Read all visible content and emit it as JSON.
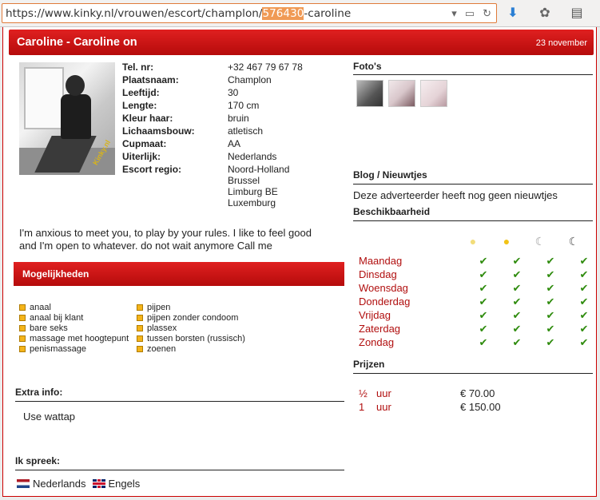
{
  "browser": {
    "url_prefix": "https://www.kinky.nl/vrouwen/escort/champlon/",
    "url_highlight": "576430",
    "url_suffix": "-caroline",
    "dropdown_icon": "chevron-down-icon",
    "reader_icon": "reader-view-icon",
    "reload_icon": "reload-icon",
    "download_icon": "download-arrow-icon",
    "extension_icon": "extension-icon",
    "clipboard_icon": "clipboard-icon"
  },
  "header": {
    "title": "Caroline - Caroline on",
    "date": "23 november"
  },
  "photo": {
    "watermark": "Kinky.nl"
  },
  "profile": {
    "rows": [
      {
        "label": "Tel. nr:",
        "value": [
          "+32 467 79 67 78"
        ]
      },
      {
        "label": "Plaatsnaam:",
        "value": [
          "Champlon"
        ]
      },
      {
        "label": "Leeftijd:",
        "value": [
          "30"
        ]
      },
      {
        "label": "Lengte:",
        "value": [
          "170 cm"
        ]
      },
      {
        "label": "Kleur haar:",
        "value": [
          "bruin"
        ]
      },
      {
        "label": "Lichaamsbouw:",
        "value": [
          "atletisch"
        ]
      },
      {
        "label": "Cupmaat:",
        "value": [
          "AA"
        ]
      },
      {
        "label": "Uiterlijk:",
        "value": [
          "Nederlands"
        ]
      },
      {
        "label": "Escort regio:",
        "value": [
          "Noord-Holland",
          "Brussel",
          "Limburg BE",
          "Luxemburg"
        ]
      }
    ],
    "description": "I'm anxious to meet you, to play by your rules. I like to feel good and I'm open to whatever. do not wait anymore Call me"
  },
  "mogelijkheden": {
    "title": "Mogelijkheden",
    "col1": [
      "anaal",
      "anaal bij klant",
      "bare seks",
      "massage met hoogtepunt",
      "penismassage"
    ],
    "col2": [
      "pijpen",
      "pijpen zonder condoom",
      "plassex",
      "tussen borsten (russisch)",
      "zoenen"
    ]
  },
  "extra": {
    "title": "Extra info:",
    "text": "Use wattap"
  },
  "languages": {
    "title": "Ik spreek:",
    "items": [
      "Nederlands",
      "Engels"
    ]
  },
  "fotos": {
    "title": "Foto's"
  },
  "blog": {
    "title": "Blog / Nieuwtjes",
    "text": "Deze adverteerder heeft nog geen nieuwtjes"
  },
  "availability": {
    "title": "Beschikbaarheid",
    "period_icons": [
      "morning-sun-icon",
      "afternoon-sun-icon",
      "evening-moon-icon",
      "night-moon-icon"
    ],
    "days": [
      "Maandag",
      "Dinsdag",
      "Woensdag",
      "Donderdag",
      "Vrijdag",
      "Zaterdag",
      "Zondag"
    ],
    "check_glyph": "✔"
  },
  "prices": {
    "title": "Prijzen",
    "rows": [
      {
        "qty": "½",
        "unit": "uur",
        "amount": "€ 70.00"
      },
      {
        "qty": "1",
        "unit": "uur",
        "amount": "€ 150.00"
      }
    ]
  },
  "colors": {
    "accent_red": "#c41212",
    "day_text": "#b10f0f",
    "check_green": "#2e8b0d"
  }
}
